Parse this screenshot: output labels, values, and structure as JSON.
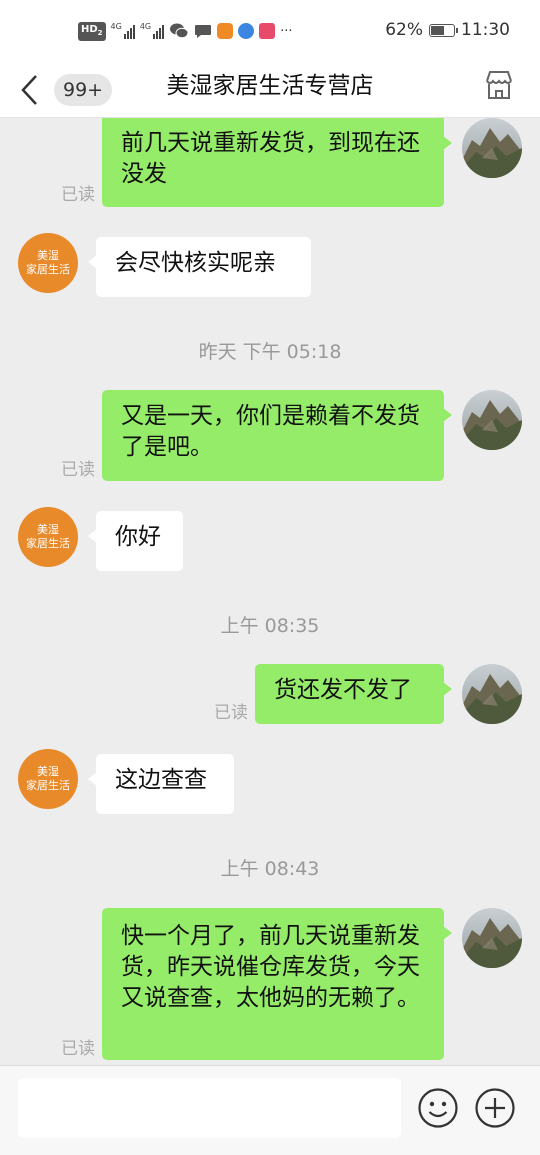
{
  "status_bar": {
    "hd": "HD",
    "hd_sub": "2",
    "net1": "4G",
    "net2": "4G",
    "more": "···",
    "battery": "62%",
    "battery_level": 0.62,
    "time": "11:30"
  },
  "header": {
    "unread_count": "99+",
    "shop_name": "美湿家居生活专营店"
  },
  "shop_avatar_text": [
    "美湿",
    "家居生活"
  ],
  "messages": [
    {
      "side": "out",
      "text": "前几天说重新发货，到现在还没发",
      "read": "已读"
    },
    {
      "side": "in",
      "text": "会尽快核实呢亲"
    },
    {
      "side": "time",
      "text": "昨天 下午 05:18"
    },
    {
      "side": "out",
      "text": "又是一天，你们是赖着不发货了是吧。",
      "read": "已读"
    },
    {
      "side": "in",
      "text": "你好"
    },
    {
      "side": "time",
      "text": "上午 08:35"
    },
    {
      "side": "out",
      "text": "货还发不发了",
      "read": "已读"
    },
    {
      "side": "in",
      "text": "这边查查"
    },
    {
      "side": "time",
      "text": "上午 08:43"
    },
    {
      "side": "out",
      "text": "快一个月了，前几天说重新发货，昨天说催仓库发货，今天又说查查，太他妈的无赖了。",
      "read": "已读"
    }
  ],
  "input": {
    "value": "",
    "placeholder": ""
  },
  "icons": {
    "back": "chevron-left-icon",
    "store": "store-icon",
    "emoji": "emoji-icon",
    "add": "plus-circle-icon"
  },
  "colors": {
    "outgoing_bubble": "#95ec69",
    "incoming_bubble": "#ffffff",
    "shop_avatar": "#e98a2a",
    "chat_background": "#ededed"
  }
}
